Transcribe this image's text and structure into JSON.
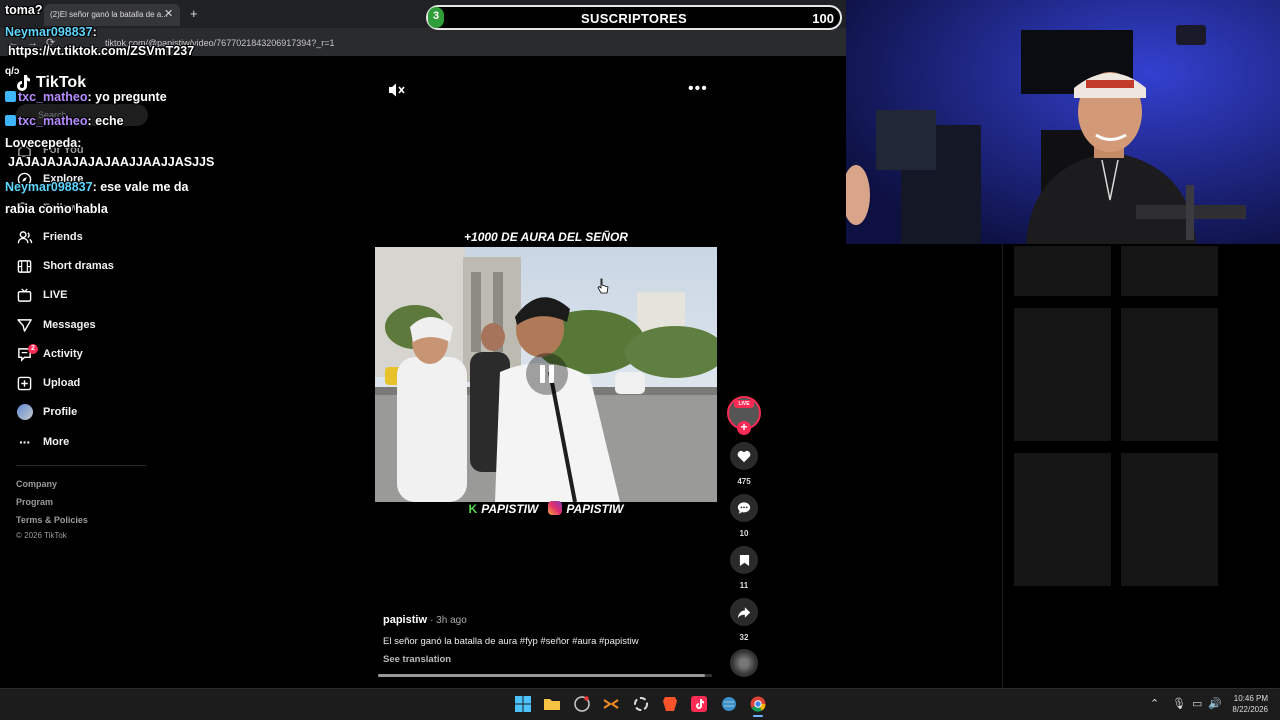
{
  "browser": {
    "tab_title": "(2)El señor ganó la batalla de a...",
    "url": "tiktok.com/@papistiw/video/767702184320691739​4?_r=1"
  },
  "subscriber_goal": {
    "label": "SUSCRIPTORES",
    "current": "3",
    "goal": "100",
    "progress_fraction": 0.03
  },
  "sidebar": {
    "logo": "TikTok",
    "search_placeholder": "Search",
    "items": [
      {
        "label": "For You",
        "icon": "home-icon"
      },
      {
        "label": "Explore",
        "icon": "compass-icon"
      },
      {
        "label": "Following",
        "icon": "following-icon"
      },
      {
        "label": "Friends",
        "icon": "friends-icon"
      },
      {
        "label": "Short dramas",
        "icon": "film-icon"
      },
      {
        "label": "LIVE",
        "icon": "live-tv-icon"
      },
      {
        "label": "Messages",
        "icon": "send-icon"
      },
      {
        "label": "Activity",
        "icon": "activity-icon",
        "badge": "2"
      },
      {
        "label": "Upload",
        "icon": "upload-icon"
      },
      {
        "label": "Profile",
        "icon": "avatar"
      },
      {
        "label": "More",
        "icon": "more-icon"
      }
    ],
    "footer": [
      "Company",
      "Program",
      "Terms & Policies"
    ],
    "copyright": "© 2026 TikTok"
  },
  "chat": [
    {
      "text": "toma?"
    },
    {
      "user": "Neymar098837",
      "text": ":"
    },
    {
      "text": "https://vt.tiktok.com/ZSVmT237"
    },
    {
      "text": "q/ɔ"
    },
    {
      "user": "txc_matheo",
      "text": ": yo pregunte"
    },
    {
      "user": "txc_matheo",
      "text": ": eche"
    },
    {
      "user": "Lovecepeda",
      "text": ":"
    },
    {
      "text": "JAJAJAJAJAJAJAAJJAAJJASJJS"
    },
    {
      "user": "Neymar098837",
      "text": ": ese vale me da"
    },
    {
      "text": "rabia como habla"
    }
  ],
  "video": {
    "caption_top": "+1000 DE AURA DEL SEÑOR",
    "watermark_left": "PAPISTIW",
    "watermark_right": "PAPISTIW",
    "author": "papistiw",
    "time_ago": "· 3h ago",
    "description": "El señor ganó la batalla de aura #fyp #señor #aura #papistiw",
    "see_translation": "See translation",
    "progress_fraction": 0.98
  },
  "actions": {
    "live_tag": "LIVE",
    "likes": "475",
    "comments": "10",
    "saves": "11",
    "shares": "32"
  },
  "taskbar": {
    "time": "10:46 PM",
    "date": "8/22/2026"
  }
}
